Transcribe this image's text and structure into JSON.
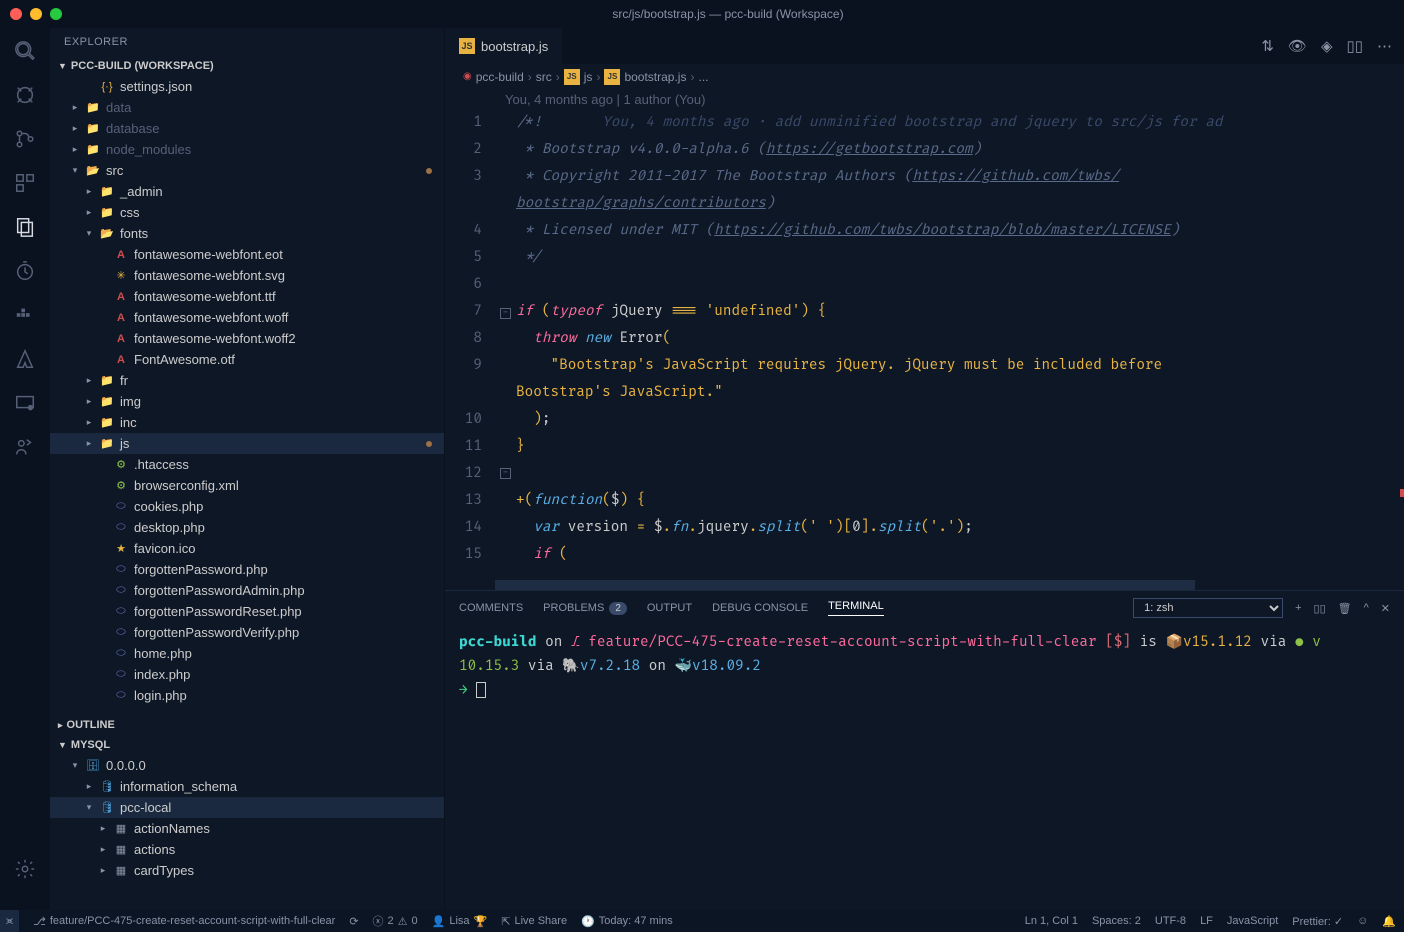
{
  "titlebar": {
    "title": "src/js/bootstrap.js — pcc-build (Workspace)"
  },
  "explorer": {
    "header": "EXPLORER",
    "workspace": "PCC-BUILD (WORKSPACE)",
    "tree": {
      "settings": "settings.json",
      "data": "data",
      "database": "database",
      "node_modules": "node_modules",
      "src": "src",
      "admin": "_admin",
      "css": "css",
      "fonts": "fonts",
      "font_files": {
        "eot": "fontawesome-webfont.eot",
        "svg": "fontawesome-webfont.svg",
        "ttf": "fontawesome-webfont.ttf",
        "woff": "fontawesome-webfont.woff",
        "woff2": "fontawesome-webfont.woff2",
        "otf": "FontAwesome.otf"
      },
      "fr": "fr",
      "img": "img",
      "inc": "inc",
      "js": "js",
      "htaccess": ".htaccess",
      "browserconfig": "browserconfig.xml",
      "cookies": "cookies.php",
      "desktop": "desktop.php",
      "favicon": "favicon.ico",
      "forgotpw": "forgottenPassword.php",
      "forgotpwadmin": "forgottenPasswordAdmin.php",
      "forgotpwreset": "forgottenPasswordReset.php",
      "forgotpwverify": "forgottenPasswordVerify.php",
      "home": "home.php",
      "index": "index.php",
      "login": "login.php"
    },
    "outline": "OUTLINE",
    "mysql": "MYSQL",
    "db": {
      "host": "0.0.0.0",
      "information_schema": "information_schema",
      "pcc_local": "pcc-local",
      "actionNames": "actionNames",
      "actions": "actions",
      "cardTypes": "cardTypes"
    }
  },
  "editor": {
    "tab": {
      "filename": "bootstrap.js",
      "icon": "JS"
    },
    "breadcrumbs": {
      "b1": "pcc-build",
      "b2": "src",
      "b3": "js",
      "b4": "bootstrap.js",
      "b5": "..."
    },
    "codelens": "You, 4 months ago | 1 author (You)",
    "lines": {
      "l1_blame": "You, 4 months ago · add unminified bootstrap and jquery to src/js for ad",
      "l2_a": " * Bootstrap v4.0.0-alpha.6 (",
      "l2_b": "https://getbootstrap.com",
      "l3_a": " * Copyright 2011-2017 The Bootstrap Authors (",
      "l3_b": "https://github.com/twbs/bootstrap/graphs/contributors",
      "l4_a": " * Licensed under MIT (",
      "l4_b": "https://github.com/twbs/bootstrap/blob/master/LICENSE",
      "l9_str": "\"Bootstrap's JavaScript requires jQuery. jQuery must be included before Bootstrap's JavaScript.\""
    }
  },
  "panel": {
    "comments": "COMMENTS",
    "problems": "PROBLEMS",
    "problems_count": "2",
    "output": "OUTPUT",
    "debug": "DEBUG CONSOLE",
    "terminal": "TERMINAL",
    "term_select": "1: zsh"
  },
  "terminal": {
    "project": "pcc-build",
    "on": " on ",
    "branch": "feature/PCC-475-create-reset-account-script-with-full-clear",
    "stash": " [$]",
    "is": " is ",
    "box": "📦",
    "v1": "v15.1.12",
    "via1": " via ",
    "dot": "● ",
    "v2": "v 10.15.3",
    "via2": " via ",
    "elephant": "🐘",
    "v3": "v7.2.18",
    "on2": " on ",
    "whale": "🐳",
    "v4": "v18.09.2",
    "prompt": "→ "
  },
  "statusbar": {
    "branch": "feature/PCC-475-create-reset-account-script-with-full-clear",
    "errors": "2",
    "warnings": "0",
    "gitlens": "Lisa",
    "liveshare": "Live Share",
    "today": "Today: 47 mins",
    "position": "Ln 1, Col 1",
    "spaces": "Spaces: 2",
    "encoding": "UTF-8",
    "eol": "LF",
    "lang": "JavaScript",
    "prettier": "Prettier: ✓"
  }
}
